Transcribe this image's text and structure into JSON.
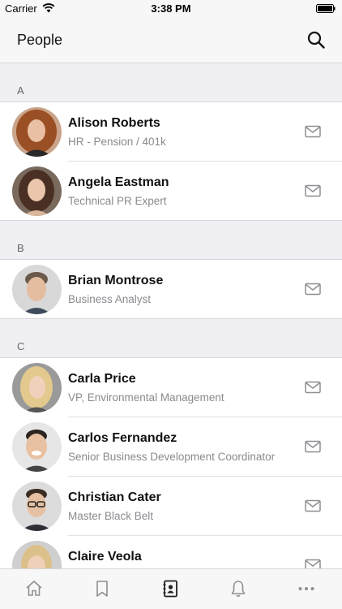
{
  "status": {
    "carrier": "Carrier",
    "time": "3:38 PM"
  },
  "nav": {
    "title": "People",
    "search_icon": "search-icon"
  },
  "sections": [
    {
      "letter": "A",
      "people": [
        {
          "name": "Alison Roberts",
          "role": "HR - Pension / 401k"
        },
        {
          "name": "Angela Eastman",
          "role": "Technical PR Expert"
        }
      ]
    },
    {
      "letter": "B",
      "people": [
        {
          "name": "Brian Montrose",
          "role": "Business Analyst"
        }
      ]
    },
    {
      "letter": "C",
      "people": [
        {
          "name": "Carla Price",
          "role": "VP, Environmental Management"
        },
        {
          "name": "Carlos Fernandez",
          "role": "Senior Business Development Coordinator"
        },
        {
          "name": "Christian Cater",
          "role": "Master Black Belt"
        },
        {
          "name": "Claire Veola",
          "role": ""
        }
      ]
    }
  ],
  "tabs": [
    {
      "icon": "home-icon",
      "active": false
    },
    {
      "icon": "bookmark-icon",
      "active": false
    },
    {
      "icon": "contacts-icon",
      "active": true
    },
    {
      "icon": "bell-icon",
      "active": false
    },
    {
      "icon": "more-icon",
      "active": false
    }
  ],
  "colors": {
    "section_bg": "#efeff4",
    "secondary_text": "#8a8a8f",
    "icon_gray": "#8e8e93",
    "active_icon": "#222222"
  }
}
